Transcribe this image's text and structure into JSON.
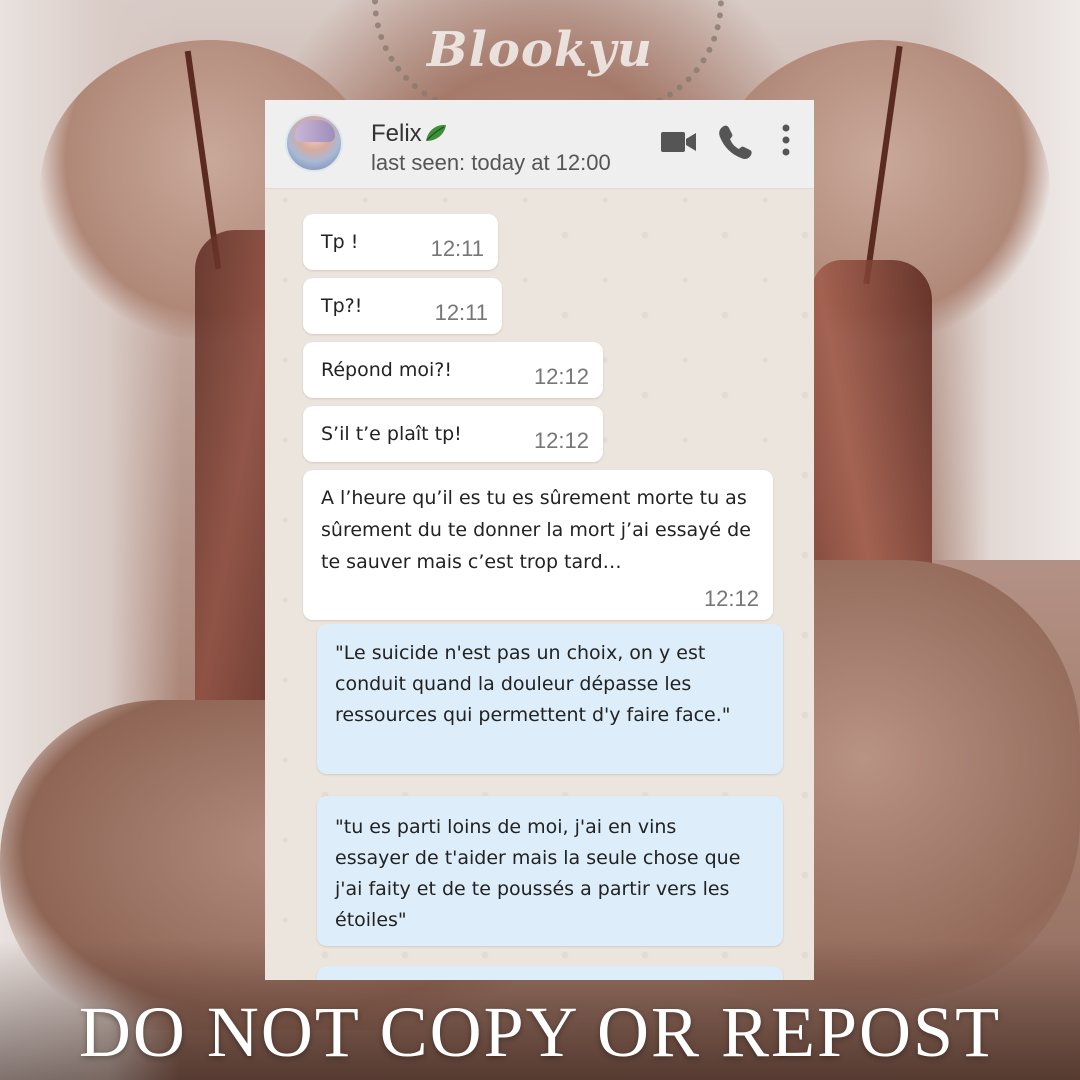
{
  "watermark": "Blookyu",
  "footer": "DO NOT COPY OR REPOST",
  "chat": {
    "contact_name": "Felix",
    "last_seen": "last seen: today at 12:00",
    "icons": {
      "video": "video-camera-icon",
      "call": "phone-icon",
      "menu": "more-vertical-icon",
      "status": "leaf-icon"
    },
    "colors": {
      "header_bg": "#efefef",
      "chat_bg": "#ece5dd",
      "incoming_bubble": "#ffffff",
      "outgoing_bubble": "#ddeefa"
    },
    "messages": [
      {
        "direction": "in",
        "text": "Tp !",
        "time": "12:11"
      },
      {
        "direction": "in",
        "text": "Tp?!",
        "time": "12:11"
      },
      {
        "direction": "in",
        "text": "Répond moi?!",
        "time": "12:12"
      },
      {
        "direction": "in",
        "text": "S’il t’e plaît tp!",
        "time": "12:12"
      },
      {
        "direction": "in",
        "text": "A l’heure qu’il es tu es sûrement morte tu as sûrement du te donner la mort j’ai essayé de te sauver mais c’est trop tard…",
        "time": "12:12"
      },
      {
        "direction": "out",
        "text": "\"Le suicide n'est pas un choix, on y est conduit quand la douleur dépasse les ressources qui permettent d'y faire face.\""
      },
      {
        "direction": "out",
        "text": "\"tu es parti loins de moi, j'ai en vins essayer de t'aider mais la seule chose que j'ai faity et de te poussés a partir vers les étoiles\""
      }
    ]
  }
}
